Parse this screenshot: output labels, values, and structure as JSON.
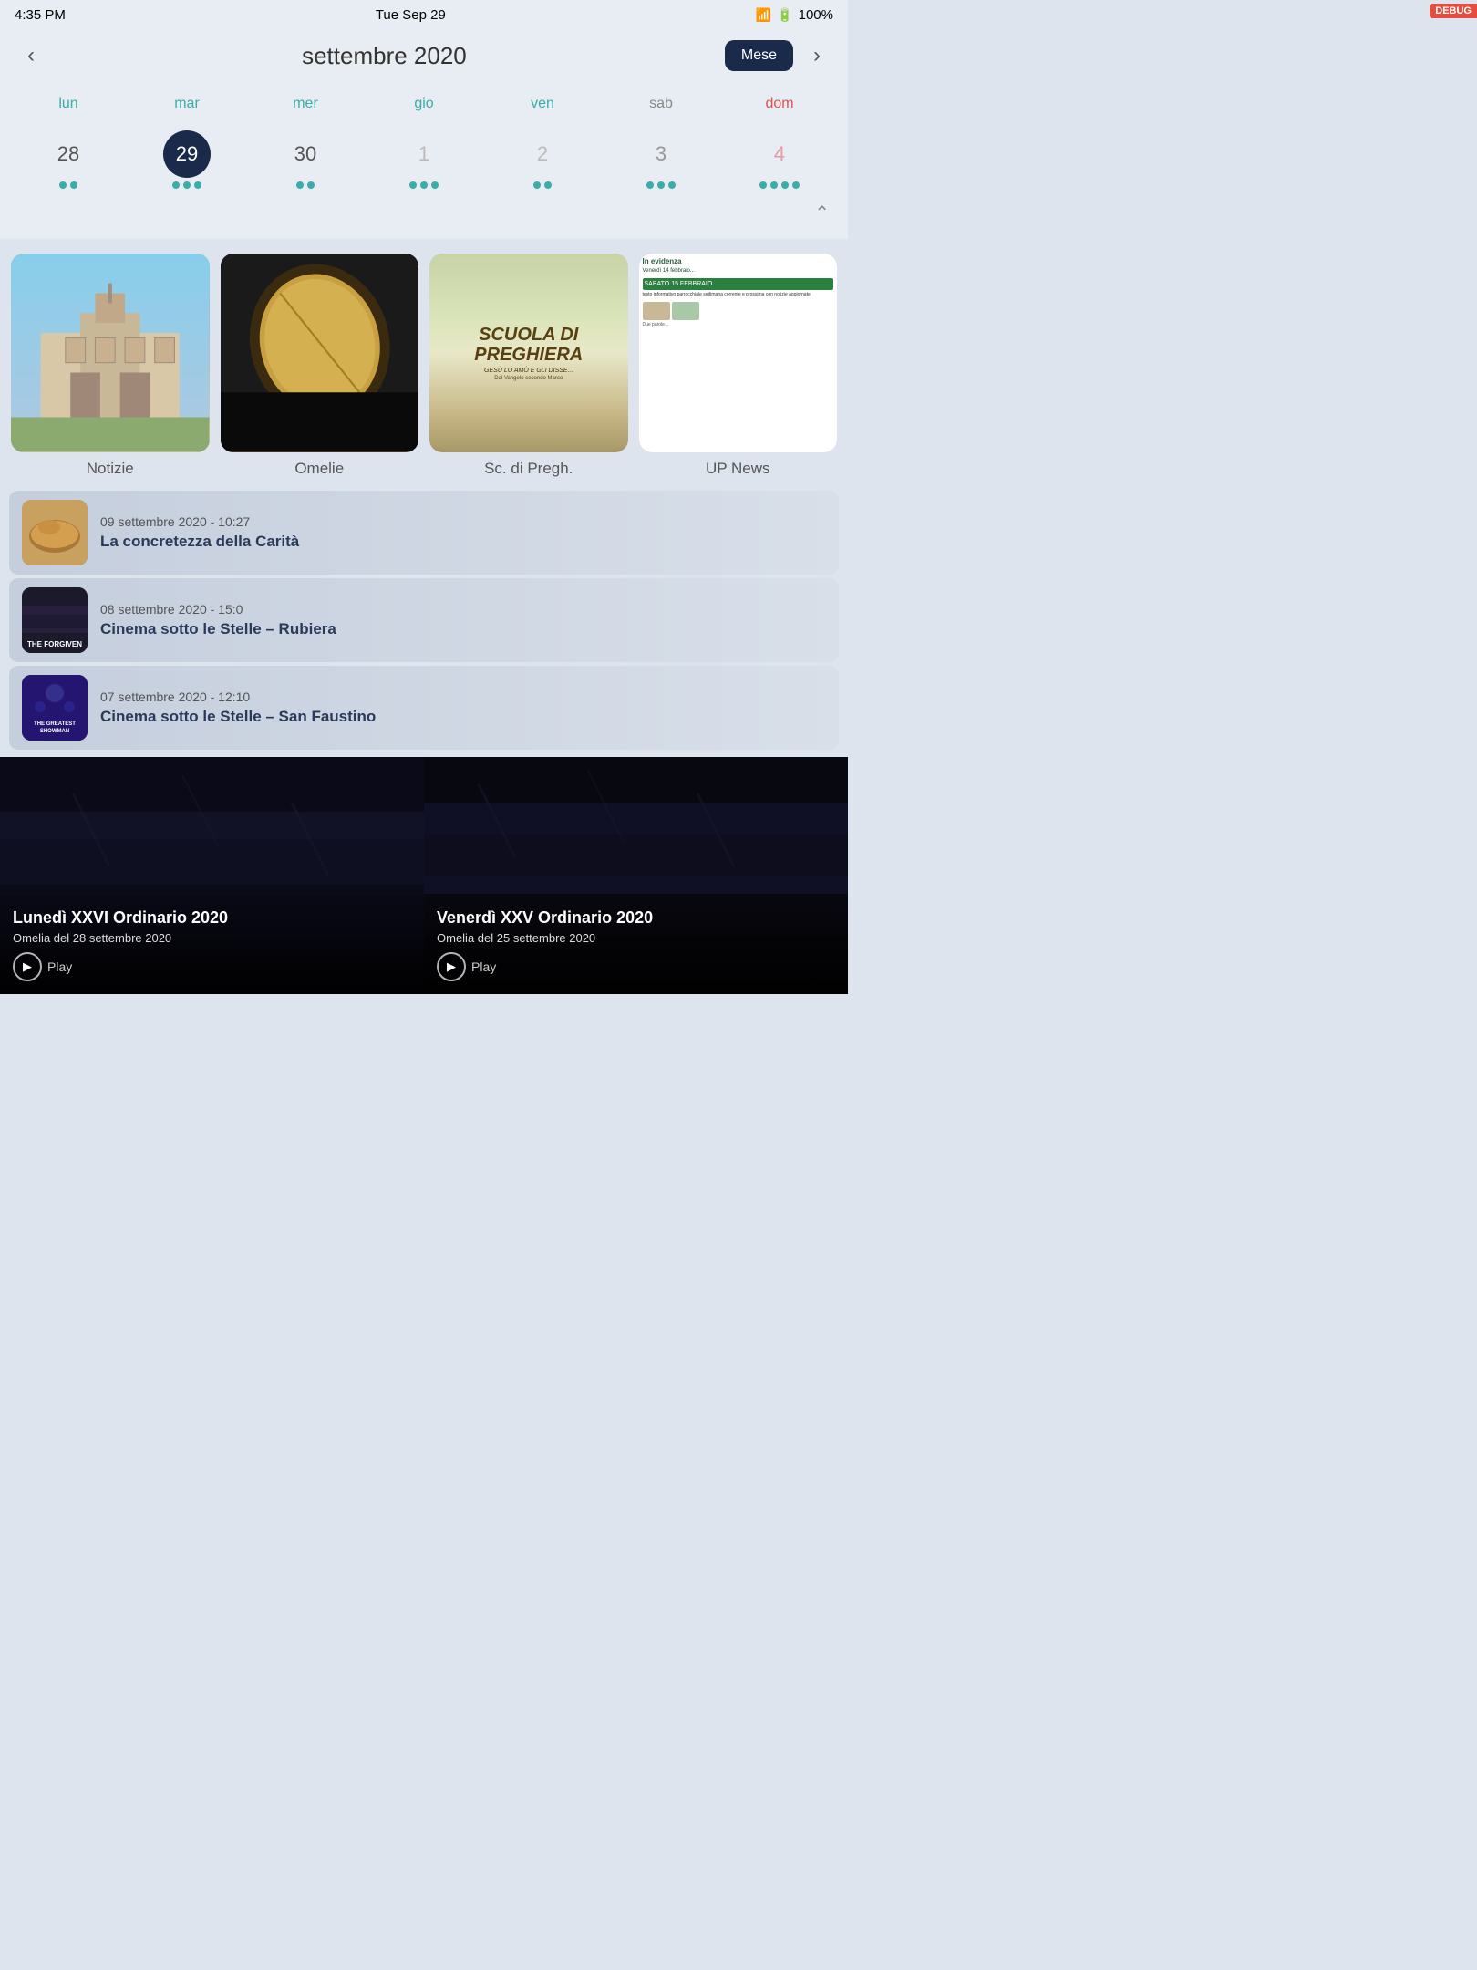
{
  "status_bar": {
    "time": "4:35 PM",
    "date": "Tue Sep 29",
    "battery": "100%"
  },
  "calendar_header": {
    "prev_label": "‹",
    "next_label": "›",
    "month_title": "settembre 2020",
    "mese_label": "Mese"
  },
  "day_headers": [
    {
      "label": "lun",
      "style": "teal"
    },
    {
      "label": "mar",
      "style": "teal"
    },
    {
      "label": "mer",
      "style": "teal"
    },
    {
      "label": "gio",
      "style": "teal"
    },
    {
      "label": "ven",
      "style": "teal"
    },
    {
      "label": "sab",
      "style": "gray"
    },
    {
      "label": "dom",
      "style": "red"
    }
  ],
  "week_dates": [
    {
      "num": "28",
      "style": "normal",
      "dots": 2
    },
    {
      "num": "29",
      "style": "selected",
      "dots": 3
    },
    {
      "num": "30",
      "style": "normal",
      "dots": 2
    },
    {
      "num": "1",
      "style": "light",
      "dots": 3
    },
    {
      "num": "2",
      "style": "light",
      "dots": 2
    },
    {
      "num": "3",
      "style": "sab-color",
      "dots": 3
    },
    {
      "num": "4",
      "style": "dom-color",
      "dots": 4
    }
  ],
  "categories": [
    {
      "label": "Notizie",
      "type": "church"
    },
    {
      "label": "Omelie",
      "type": "bible"
    },
    {
      "label": "Sc. di Pregh.",
      "type": "preghiera"
    },
    {
      "label": "UP News",
      "type": "upnews"
    }
  ],
  "articles": [
    {
      "date": "09 settembre 2020 - 10:27",
      "title": "La concretezza della Carità",
      "thumb_type": "bread"
    },
    {
      "date": "08 settembre 2020 - 15:0",
      "title": "Cinema sotto le Stelle – Rubiera",
      "thumb_type": "forgiven"
    },
    {
      "date": "07 settembre 2020 - 12:10",
      "title": "Cinema sotto le Stelle – San Faustino",
      "thumb_type": "showman"
    }
  ],
  "videos": [
    {
      "title": "Lunedì XXVI Ordinario 2020",
      "subtitle": "Omelia del 28 settembre 2020",
      "play_label": "Play",
      "bg": "left"
    },
    {
      "title": "Venerdì XXV Ordinario 2020",
      "subtitle": "Omelia del 25 settembre 2020",
      "play_label": "Play",
      "bg": "right"
    }
  ],
  "forgiven_text": "THE FORGIVEN",
  "preghiera_title": "SCUOLA DI PREGHIERA",
  "preghiera_sub": "GESÙ LO AMÒ E GLI DISSE...",
  "upnews_header": "In evidenza"
}
